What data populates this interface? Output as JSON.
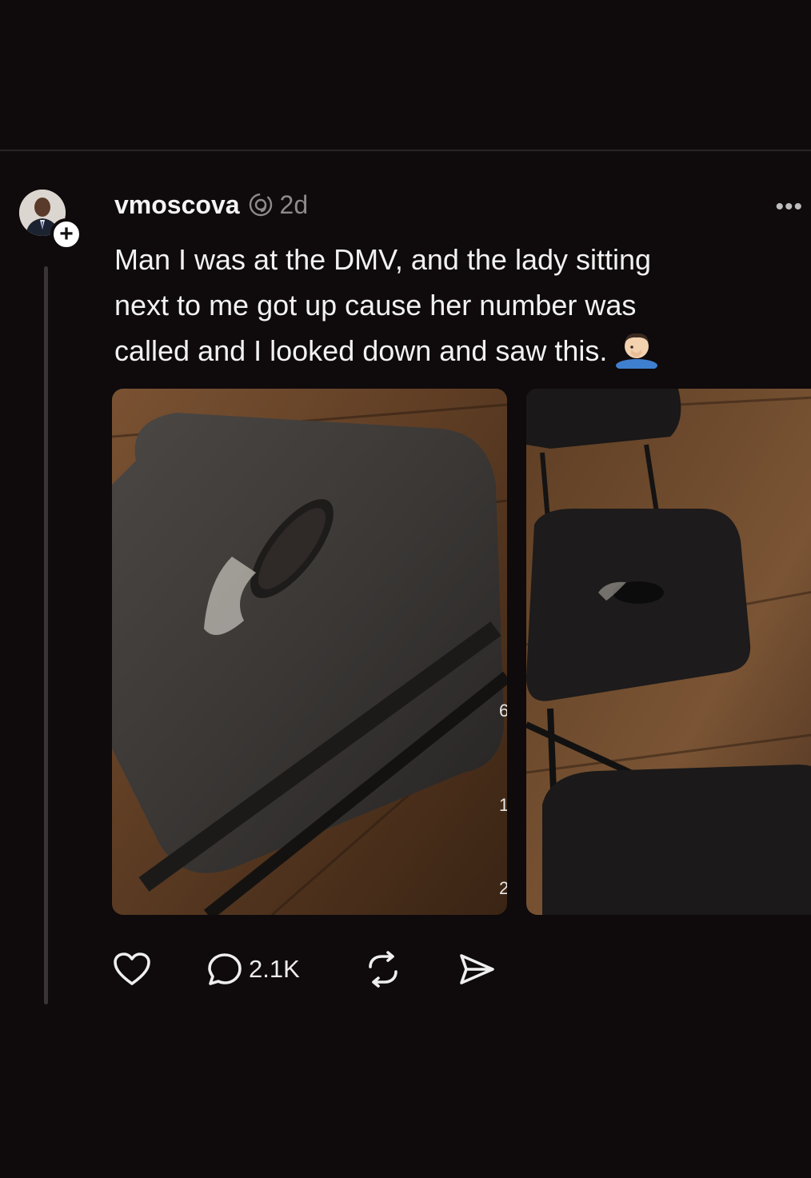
{
  "post": {
    "username": "vmoscova",
    "time": "2d",
    "more_label": "•••",
    "text": "Man I was  at the DMV, and the lady sitting\nnext to me got up cause her number was\ncalled and I looked down and saw this.",
    "emoji": "man-facepalming",
    "follow_label": "+",
    "images": [
      {
        "description": "chair-closeup"
      },
      {
        "description": "chairs-row"
      }
    ],
    "actions": {
      "like_icon": "heart-icon",
      "reply_icon": "comment-icon",
      "reply_count": "2.1K",
      "repost_icon": "repost-icon",
      "share_icon": "send-icon"
    }
  },
  "colors": {
    "background": "#0f0a0b",
    "text": "#f2f2f2",
    "muted": "#8d8a8b",
    "thread_line": "#3a3436"
  }
}
